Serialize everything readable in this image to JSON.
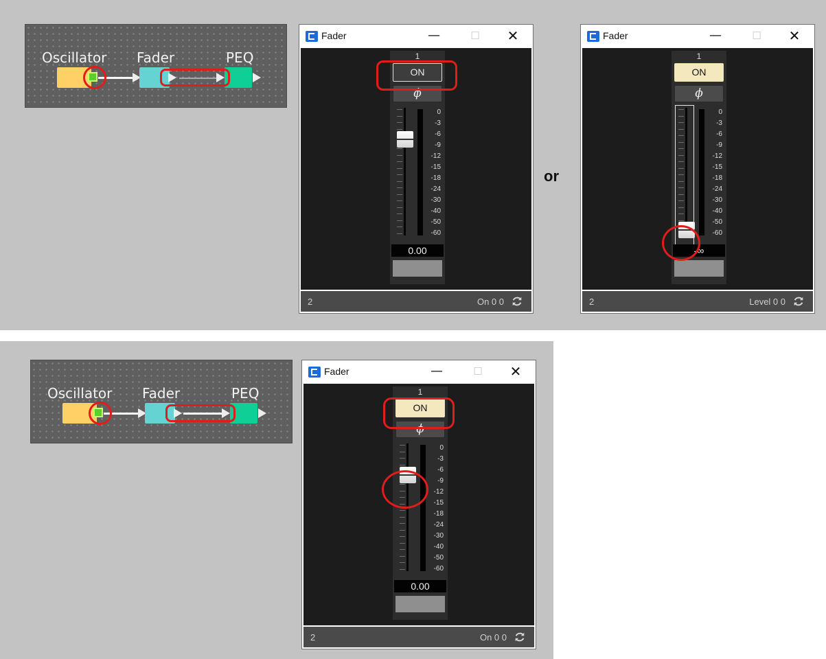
{
  "colors": {
    "background_panel": "#c3c3c3",
    "diagram_bg": "#5f5f5f",
    "oscillator_block": "#ffd066",
    "fader_block": "#66d3d3",
    "peq_block": "#10cf96",
    "port": "#59d12a",
    "highlight": "#e21b1b",
    "button_on_lit": "#f4e8be",
    "button_on_off": "#3d3d3d"
  },
  "diagrams": [
    {
      "labels": {
        "oscillator": "Oscillator",
        "fader": "Fader",
        "peq": "PEQ"
      },
      "fader_output_wire": "inactive"
    },
    {
      "labels": {
        "oscillator": "Oscillator",
        "fader": "Fader",
        "peq": "PEQ"
      },
      "fader_output_wire": "active"
    }
  ],
  "separator_text": "or",
  "windows": [
    {
      "title": "Fader",
      "controls": {
        "minimize": "—",
        "maximize": "☐",
        "close": "✕"
      },
      "channel": "1",
      "on_label": "ON",
      "on_state": "off",
      "phase_label": "ϕ",
      "meter_scale": [
        "0",
        "-3",
        "-6",
        "-9",
        "-12",
        "-15",
        "-18",
        "-24",
        "-30",
        "-40",
        "-50",
        "-60"
      ],
      "fader_level_db": "-6",
      "value": "0.00",
      "status_left": "2",
      "status_right": "On 0 0"
    },
    {
      "title": "Fader",
      "controls": {
        "minimize": "—",
        "maximize": "☐",
        "close": "✕"
      },
      "channel": "1",
      "on_label": "ON",
      "on_state": "lit",
      "phase_label": "ϕ",
      "meter_scale": [
        "0",
        "-3",
        "-6",
        "-9",
        "-12",
        "-15",
        "-18",
        "-24",
        "-30",
        "-40",
        "-50",
        "-60"
      ],
      "fader_level_db": "-∞",
      "value": "-∞",
      "status_left": "2",
      "status_right": "Level 0 0"
    },
    {
      "title": "Fader",
      "controls": {
        "minimize": "—",
        "maximize": "☐",
        "close": "✕"
      },
      "channel": "1",
      "on_label": "ON",
      "on_state": "lit",
      "phase_label": "ϕ",
      "meter_scale": [
        "0",
        "-3",
        "-6",
        "-9",
        "-12",
        "-15",
        "-18",
        "-24",
        "-30",
        "-40",
        "-50",
        "-60"
      ],
      "fader_level_db": "-6",
      "value": "0.00",
      "status_left": "2",
      "status_right": "On 0 0"
    }
  ]
}
